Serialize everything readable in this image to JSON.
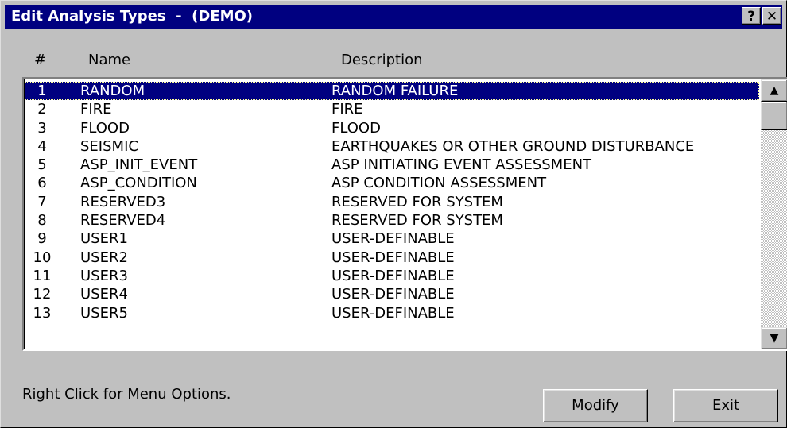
{
  "window": {
    "title": "Edit Analysis Types  -  (DEMO)",
    "help_glyph": "?",
    "close_glyph": "✕"
  },
  "columns": {
    "num": "#",
    "name": "Name",
    "description": "Description"
  },
  "rows": [
    {
      "num": "1",
      "name": "RANDOM",
      "description": "RANDOM FAILURE",
      "selected": true
    },
    {
      "num": "2",
      "name": "FIRE",
      "description": "FIRE"
    },
    {
      "num": "3",
      "name": "FLOOD",
      "description": "FLOOD"
    },
    {
      "num": "4",
      "name": "SEISMIC",
      "description": "EARTHQUAKES OR OTHER GROUND DISTURBANCE"
    },
    {
      "num": "5",
      "name": "ASP_INIT_EVENT",
      "description": "ASP INITIATING EVENT ASSESSMENT"
    },
    {
      "num": "6",
      "name": "ASP_CONDITION",
      "description": "ASP CONDITION ASSESSMENT"
    },
    {
      "num": "7",
      "name": "RESERVED3",
      "description": "RESERVED FOR SYSTEM"
    },
    {
      "num": "8",
      "name": "RESERVED4",
      "description": "RESERVED FOR SYSTEM"
    },
    {
      "num": "9",
      "name": "USER1",
      "description": "USER-DEFINABLE"
    },
    {
      "num": "10",
      "name": "USER2",
      "description": "USER-DEFINABLE"
    },
    {
      "num": "11",
      "name": "USER3",
      "description": "USER-DEFINABLE"
    },
    {
      "num": "12",
      "name": "USER4",
      "description": "USER-DEFINABLE"
    },
    {
      "num": "13",
      "name": "USER5",
      "description": "USER-DEFINABLE"
    }
  ],
  "scrollbar": {
    "up_glyph": "▲",
    "down_glyph": "▼"
  },
  "status_text": "Right Click for Menu Options.",
  "buttons": {
    "modify": {
      "accel": "M",
      "rest": "odify"
    },
    "exit": {
      "accel": "E",
      "rest": "xit"
    }
  },
  "colors": {
    "titlebar": "#000080",
    "face": "#c0c0c0",
    "selection": "#000080",
    "selection_text": "#ffffff"
  }
}
